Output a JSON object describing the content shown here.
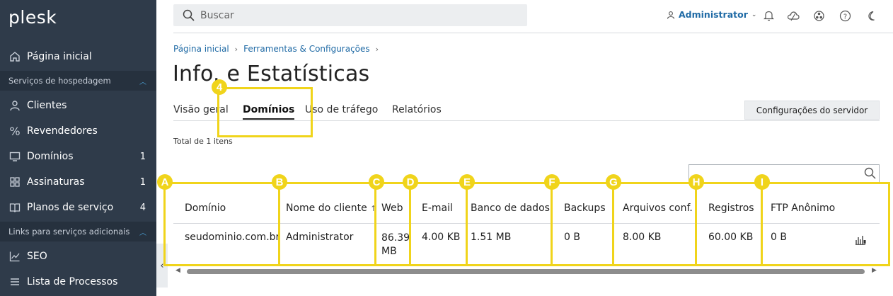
{
  "sidebar": {
    "logo": "plesk",
    "home": "Página inicial",
    "section_hosting": "Serviços de hospedagem",
    "items": [
      {
        "label": "Clientes",
        "count": ""
      },
      {
        "label": "Revendedores",
        "count": ""
      },
      {
        "label": "Domínios",
        "count": "1"
      },
      {
        "label": "Assinaturas",
        "count": "1"
      },
      {
        "label": "Planos de serviço",
        "count": "4"
      }
    ],
    "section_links": "Links para serviços adicionais",
    "links": [
      {
        "label": "SEO"
      },
      {
        "label": "Lista de Processos"
      }
    ],
    "collapse_glyph": "‹"
  },
  "topbar": {
    "search_placeholder": "Buscar",
    "user": "Administrator",
    "icons": [
      "notifications-icon",
      "cloud-icon",
      "extensions-icon",
      "help-icon",
      "dark-mode-icon"
    ]
  },
  "breadcrumb": [
    "Página inicial",
    "Ferramentas & Configurações"
  ],
  "page_title": "Info. e Estatísticas",
  "tabs": [
    "Visão geral",
    "Domínios",
    "Uso de tráfego",
    "Relatórios"
  ],
  "active_tab": "Domínios",
  "server_button": "Configurações do servidor",
  "total_text": "Total de 1 itens",
  "table": {
    "columns": [
      "Domínio",
      "Nome do cliente",
      "Web",
      "E-mail",
      "Banco de dados",
      "Backups",
      "Arquivos conf.",
      "Registros",
      "FTP Anônimo"
    ],
    "sort_indicator": "↑",
    "rows": [
      [
        "seudominio.com.br",
        "Administrator",
        "86.39 MB",
        "4.00 KB",
        "1.51 MB",
        "0 B",
        "8.00 KB",
        "60.00 KB",
        "0 B"
      ]
    ]
  },
  "annotations": [
    "4",
    "A",
    "B",
    "C",
    "D",
    "E",
    "F",
    "G",
    "H",
    "I"
  ],
  "colors": {
    "sidebar_bg": "#2f3b4a",
    "section_bg": "#26313e",
    "link": "#1f6aa5",
    "annotation": "#f0d41b"
  }
}
